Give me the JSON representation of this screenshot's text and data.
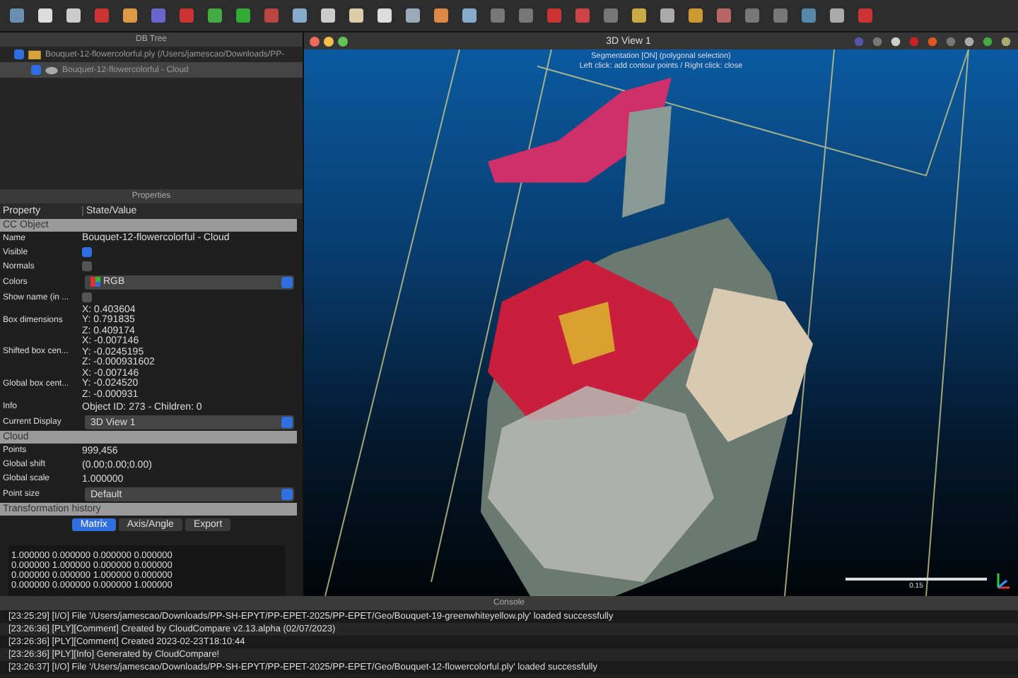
{
  "db_tree": {
    "title": "DB Tree",
    "items": [
      {
        "label": "Bouquet-12-flowercolorful.ply (/Users/jamescao/Downloads/PP-",
        "checked": true,
        "selected": false,
        "children": [
          {
            "label": "Bouquet-12-flowercolorful - Cloud",
            "checked": true,
            "selected": true
          }
        ]
      }
    ]
  },
  "properties": {
    "title": "Properties",
    "columns": [
      "Property",
      "State/Value"
    ],
    "sections": [
      {
        "title": "CC Object",
        "rows": [
          {
            "kind": "text",
            "label": "Name",
            "value": "Bouquet-12-flowercolorful - Cloud"
          },
          {
            "kind": "checkbox",
            "label": "Visible",
            "checked": true
          },
          {
            "kind": "checkbox",
            "label": "Normals",
            "checked": false
          },
          {
            "kind": "combo",
            "label": "Colors",
            "value": "RGB"
          },
          {
            "kind": "checkbox",
            "label": "Show name (in ...",
            "checked": false
          },
          {
            "kind": "multi",
            "label": "Box dimensions",
            "lines": [
              "X: 0.403604",
              "Y: 0.791835",
              "Z: 0.409174"
            ]
          },
          {
            "kind": "multi",
            "label": "Shifted box cen...",
            "lines": [
              "X: -0.007146",
              "Y: -0.0245195",
              "Z: -0.000931602"
            ]
          },
          {
            "kind": "multi",
            "label": "Global box cent...",
            "lines": [
              "X: -0.007146",
              "Y: -0.024520",
              "Z: -0.000931"
            ]
          },
          {
            "kind": "text",
            "label": "Info",
            "value": "Object ID: 273 - Children: 0"
          },
          {
            "kind": "combo",
            "label": "Current Display",
            "value": "3D View 1"
          }
        ]
      },
      {
        "title": "Cloud",
        "rows": [
          {
            "kind": "text",
            "label": "Points",
            "value": "999,456"
          },
          {
            "kind": "text",
            "label": "Global shift",
            "value": "(0.00;0.00;0.00)"
          },
          {
            "kind": "text",
            "label": "Global scale",
            "value": "1.000000"
          },
          {
            "kind": "combo",
            "label": "Point size",
            "value": "Default"
          }
        ]
      }
    ],
    "transformation": {
      "title": "Transformation history",
      "tabs": [
        {
          "label": "Matrix",
          "selected": true
        },
        {
          "label": "Axis/Angle",
          "selected": false
        },
        {
          "label": "Export",
          "selected": false
        }
      ],
      "matrix": [
        "1.000000 0.000000 0.000000 0.000000",
        "0.000000 1.000000 0.000000 0.000000",
        "0.000000 0.000000 1.000000 0.000000",
        "0.000000 0.000000 0.000000 1.000000"
      ]
    }
  },
  "view": {
    "title": "3D View 1",
    "messages": [
      "Segmentation [ON] (polygonal selection)",
      "Left click: add contour points / Right click: close"
    ],
    "scale_label": "0.15"
  },
  "console": {
    "title": "Console",
    "lines": [
      "[23:25:29] [I/O] File '/Users/jamescao/Downloads/PP-SH-EPYT/PP-EPET-2025/PP-EPET/Geo/Bouquet-19-greenwhiteyellow.ply' loaded successfully",
      "[23:26:36] [PLY][Comment] Created by CloudCompare v2.13.alpha (02/07/2023)",
      "[23:26:36] [PLY][Comment] Created 2023-02-23T18:10:44",
      "[23:26:36] [PLY][Info] Generated by CloudCompare!",
      "[23:26:37] [I/O] File '/Users/jamescao/Downloads/PP-SH-EPYT/PP-EPET-2025/PP-EPET/Geo/Bouquet-12-flowercolorful.ply' loaded successfully"
    ]
  }
}
